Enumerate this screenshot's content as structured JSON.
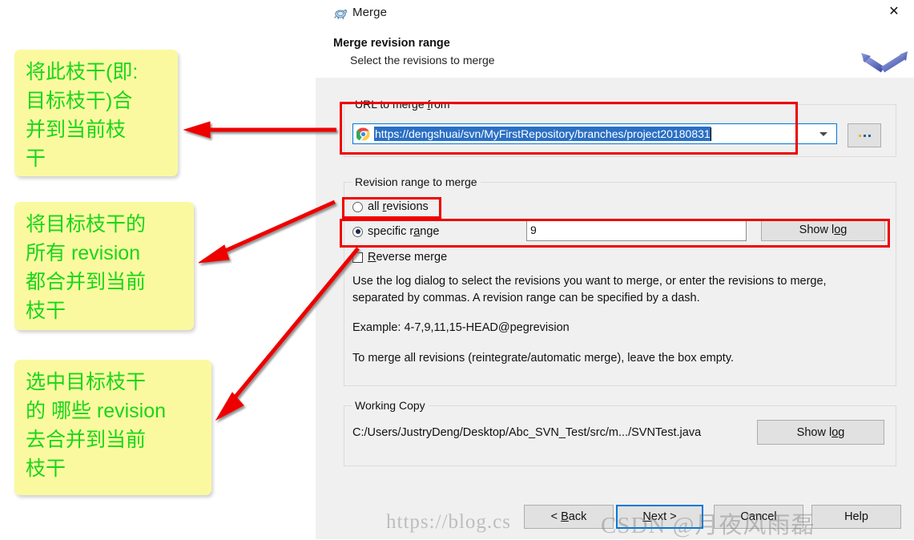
{
  "window": {
    "title": "Merge",
    "title_icon": "tortoisesvn-turtle-icon",
    "close_label": "✕"
  },
  "header": {
    "title": "Merge revision range",
    "subtitle": "Select the revisions to merge",
    "art_icon": "merge-arrow-graphic"
  },
  "url_group": {
    "legend_before": "URL to merge ",
    "legend_accel": "f",
    "legend_after": "rom",
    "combo": {
      "icon": "chrome-browser-icon",
      "value": "https://dengshuai/svn/MyFirstRepository/branches/project20180831",
      "dropdown_icon": "chevron-down-icon"
    },
    "browse_button": "..."
  },
  "revision_group": {
    "legend": "Revision range to merge",
    "all_revisions": {
      "before": "all ",
      "accel": "r",
      "after": "evisions",
      "checked": false
    },
    "specific_range": {
      "before": "specific r",
      "accel": "a",
      "after": "nge",
      "checked": true
    },
    "reverse_merge": {
      "before": "",
      "accel": "R",
      "after": "everse merge",
      "checked": false
    },
    "revision_input_value": "9",
    "show_log_before": "Show l",
    "show_log_accel": "o",
    "show_log_after": "g",
    "description_1": "Use the log dialog to select the revisions you want to merge, or enter the revisions to merge, separated by commas. A revision range can be specified by a dash.",
    "description_2": "Example: 4-7,9,11,15-HEAD@pegrevision",
    "description_3": "To merge all revisions (reintegrate/automatic merge), leave the box empty."
  },
  "working_copy_group": {
    "legend": "Working Copy",
    "path": "C:/Users/JustryDeng/Desktop/Abc_SVN_Test/src/m.../SVNTest.java",
    "show_log_before": "Show l",
    "show_log_accel": "o",
    "show_log_after": "g"
  },
  "footer": {
    "back_before": "< ",
    "back_accel": "B",
    "back_after": "ack",
    "next_accel": "N",
    "next_after": "ext >",
    "cancel_before": "Cancel",
    "cancel_accel": "",
    "help_before": "Help"
  },
  "annotations": {
    "note_1_lines": [
      "将此枝干(即:",
      "目标枝干)合",
      "并到当前枝",
      "干"
    ],
    "note_2_lines": [
      "将目标枝干的",
      "所有 revision",
      "都合并到当前",
      "枝干"
    ],
    "note_3_lines": [
      "选中目标枝干",
      "的 哪些 revision",
      "去合并到当前",
      "枝干"
    ],
    "highlight_color": "#ee0000",
    "note_bg_color": "#fbf9a0",
    "note_text_color": "#19d619"
  },
  "watermark": {
    "url_text": "https://blog.cs",
    "brand_text": "CSDN @月夜风雨磊"
  }
}
